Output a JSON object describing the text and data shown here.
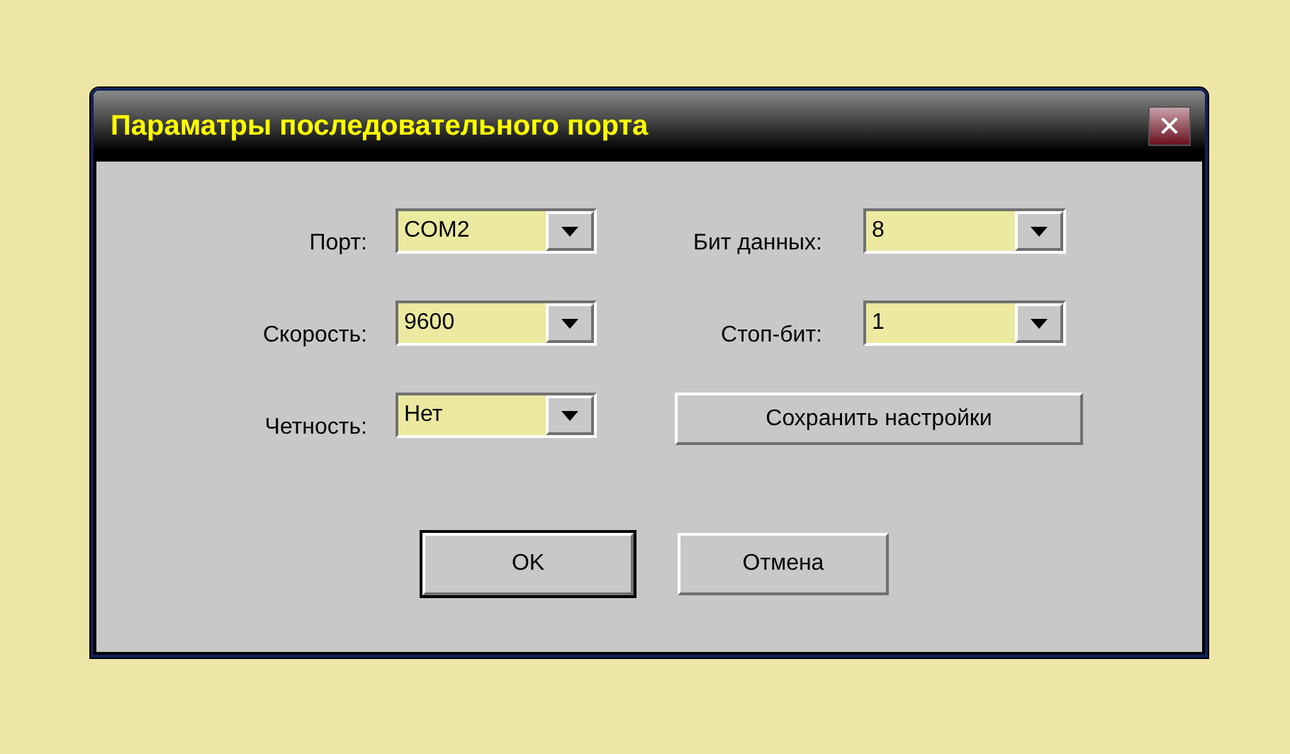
{
  "window": {
    "title": "Параматры последовательного порта",
    "close_icon": "✕"
  },
  "left_fields": [
    {
      "label": "Порт:",
      "value": "COM2"
    },
    {
      "label": "Скорость:",
      "value": "9600"
    },
    {
      "label": "Четность:",
      "value": "Нет"
    }
  ],
  "right_fields": [
    {
      "label": "Бит данных:",
      "value": "8"
    },
    {
      "label": "Стоп-бит:",
      "value": "1"
    }
  ],
  "save_button": "Сохранить настройки",
  "buttons": [
    {
      "label": "OK",
      "default": true
    },
    {
      "label": "Отмена",
      "default": false
    }
  ]
}
